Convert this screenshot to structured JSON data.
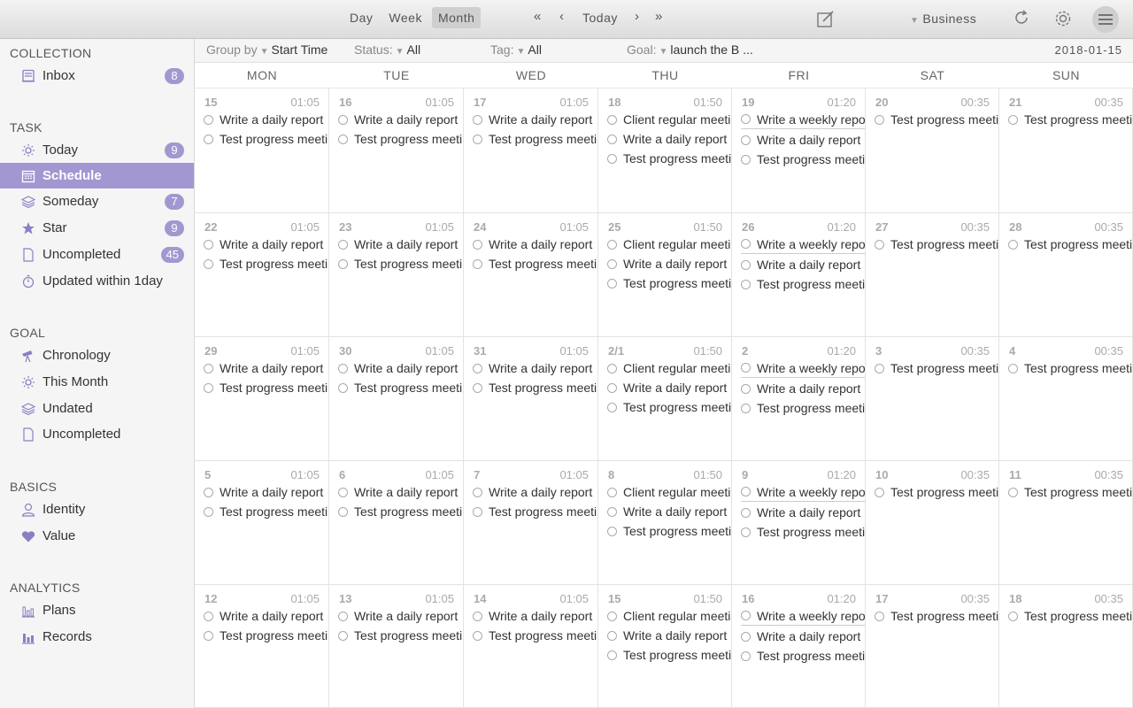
{
  "toolbar": {
    "views": [
      "Day",
      "Week",
      "Month"
    ],
    "active_view": "Month",
    "today_label": "Today",
    "first_label": "«",
    "prev_label": "‹",
    "next_label": "›",
    "last_label": "»",
    "business_label": "Business"
  },
  "sidebar": {
    "collection_title": "COLLECTION",
    "task_title": "TASK",
    "goal_title": "GOAL",
    "basics_title": "BASICS",
    "analytics_title": "ANALYTICS",
    "inbox": {
      "label": "Inbox",
      "badge": "8"
    },
    "today": {
      "label": "Today",
      "badge": "9"
    },
    "schedule": {
      "label": "Schedule"
    },
    "someday": {
      "label": "Someday",
      "badge": "7"
    },
    "star": {
      "label": "Star",
      "badge": "9"
    },
    "uncompleted": {
      "label": "Uncompleted",
      "badge": "45"
    },
    "updated": {
      "label": "Updated within 1day"
    },
    "chronology": {
      "label": "Chronology"
    },
    "this_month": {
      "label": "This Month"
    },
    "undated": {
      "label": "Undated"
    },
    "goal_uncompleted": {
      "label": "Uncompleted"
    },
    "identity": {
      "label": "Identity"
    },
    "value": {
      "label": "Value"
    },
    "plans": {
      "label": "Plans"
    },
    "records": {
      "label": "Records"
    }
  },
  "filters": {
    "group_by_label": "Group by",
    "group_by_value": "Start Time",
    "status_label": "Status:",
    "status_value": "All",
    "tag_label": "Tag:",
    "tag_value": "All",
    "goal_label": "Goal:",
    "goal_value": "launch the B ...",
    "date": "2018-01-15"
  },
  "weekdays": [
    "MON",
    "TUE",
    "WED",
    "THU",
    "FRI",
    "SAT",
    "SUN"
  ],
  "weeks": [
    [
      "15",
      "16",
      "17",
      "18",
      "19",
      "20",
      "21"
    ],
    [
      "22",
      "23",
      "24",
      "25",
      "26",
      "27",
      "28"
    ],
    [
      "29",
      "30",
      "31",
      "2/1",
      "2",
      "3",
      "4"
    ],
    [
      "5",
      "6",
      "7",
      "8",
      "9",
      "10",
      "11"
    ],
    [
      "12",
      "13",
      "14",
      "15",
      "16",
      "17",
      "18"
    ]
  ],
  "day_templates": [
    {
      "time": "01:05",
      "tasks": [
        "Write a daily report",
        "Test progress meeting"
      ]
    },
    {
      "time": "01:05",
      "tasks": [
        "Write a daily report",
        "Test progress meeting"
      ]
    },
    {
      "time": "01:05",
      "tasks": [
        "Write a daily report",
        "Test progress meeting"
      ]
    },
    {
      "time": "01:50",
      "tasks": [
        "Client regular meeting",
        "Write a daily report",
        "Test progress meeting"
      ]
    },
    {
      "time": "01:20",
      "tasks": [
        "Write a weekly report",
        "Write a daily report",
        "Test progress meeting"
      ],
      "first_separated": true
    },
    {
      "time": "00:35",
      "tasks": [
        "Test progress meeting"
      ]
    },
    {
      "time": "00:35",
      "tasks": [
        "Test progress meeting"
      ]
    }
  ]
}
